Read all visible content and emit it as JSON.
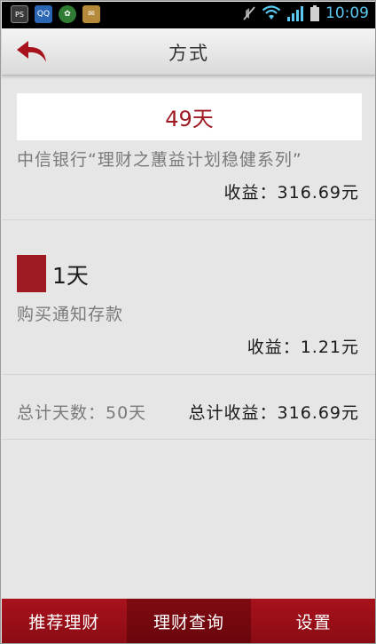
{
  "statusbar": {
    "time": "10:09",
    "left_icons": [
      "PS",
      "QQ",
      "✿",
      "✉"
    ]
  },
  "header": {
    "title": "方式"
  },
  "plan1": {
    "days": "49天",
    "product": "中信银行“理财之蕙益计划稳健系列”",
    "earnings": "收益：316.69元"
  },
  "plan2": {
    "days": "1天",
    "product": "购买通知存款",
    "earnings": "收益：1.21元"
  },
  "totals": {
    "days": "总计天数：50天",
    "earnings": "总计收益：316.69元"
  },
  "nav": {
    "items": [
      {
        "label": "推荐理财"
      },
      {
        "label": "理财查询"
      },
      {
        "label": "设置"
      }
    ]
  },
  "colors": {
    "accent_red": "#9e1b24",
    "nav_red": "#a8121c",
    "time_blue": "#5ac8f0"
  }
}
